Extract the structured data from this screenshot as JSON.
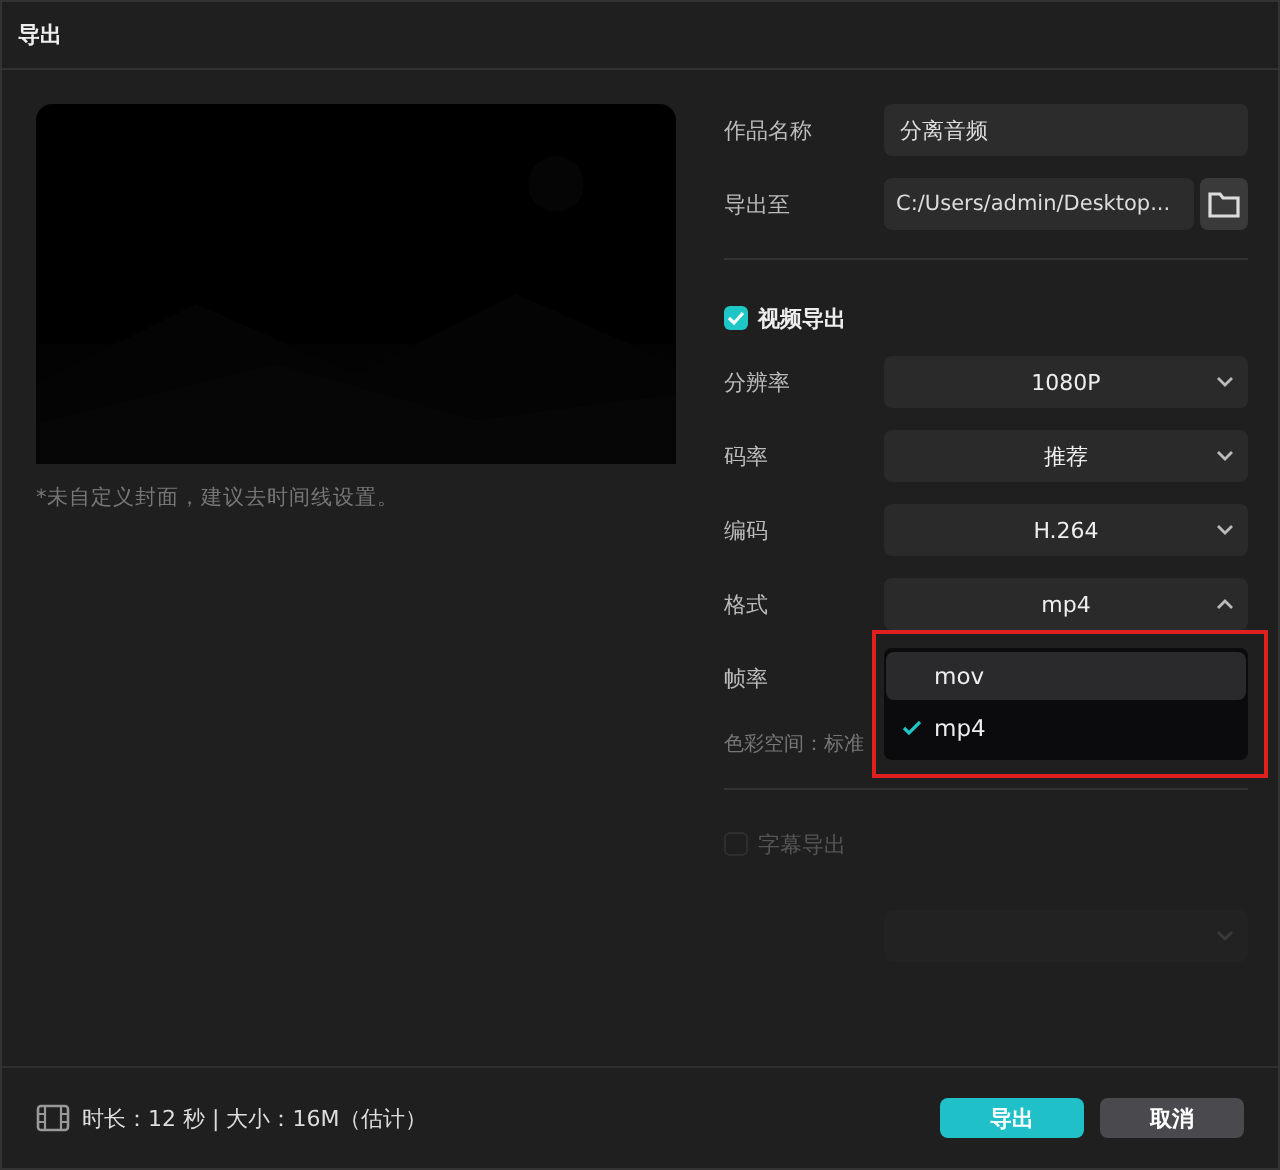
{
  "window": {
    "title": "导出"
  },
  "preview": {
    "note": "*未自定义封面，建议去时间线设置。"
  },
  "fields": [
    {
      "label": "作品名称",
      "kind": "text",
      "value": "分离音频"
    },
    {
      "label": "导出至",
      "kind": "path",
      "value": "C:/Users/admin/Desktop..."
    }
  ],
  "video_export": {
    "label": "视频导出",
    "checked": true
  },
  "settings": [
    {
      "label": "分辨率",
      "value": "1080P",
      "expanded": false
    },
    {
      "label": "码率",
      "value": "推荐",
      "expanded": false
    },
    {
      "label": "编码",
      "value": "H.264",
      "expanded": false
    },
    {
      "label": "格式",
      "value": "mp4",
      "expanded": true
    }
  ],
  "frame_rate": {
    "label": "帧率"
  },
  "format_menu": {
    "highlighted": true,
    "options": [
      {
        "label": "mov",
        "hovered": true,
        "selected": false
      },
      {
        "label": "mp4",
        "hovered": false,
        "selected": true
      }
    ]
  },
  "color_space": {
    "label": "色彩空间：",
    "value": "标准"
  },
  "subtitle_export": {
    "label": "字幕导出",
    "checked": false,
    "disabled": true
  },
  "footer": {
    "info": "时长：12 秒 | 大小：16M（估计）",
    "buttons": [
      {
        "label": "导出",
        "kind": "primary"
      },
      {
        "label": "取消",
        "kind": "secondary"
      }
    ]
  }
}
